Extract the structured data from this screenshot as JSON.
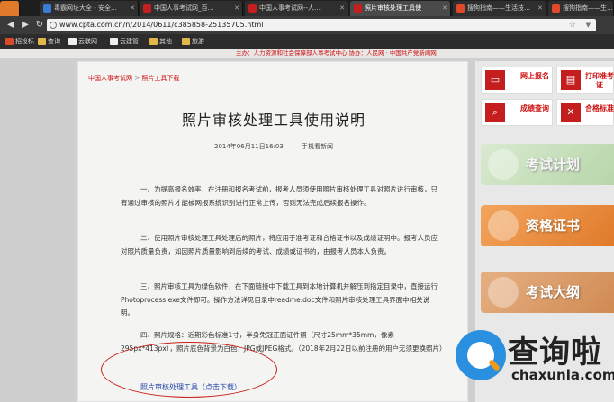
{
  "browser": {
    "tabs": [
      {
        "label": "毒霸网址大全 - 安全…",
        "color": "#3a7bd5"
      },
      {
        "label": "中国人事考试网_百…",
        "color": "#c41e1e"
      },
      {
        "label": "中国人事考试网--人…",
        "color": "#c41e1e"
      },
      {
        "label": "照片审核处理工具使",
        "color": "#c41e1e"
      },
      {
        "label": "搜狗指南——生活技…",
        "color": "#e04a2a"
      },
      {
        "label": "搜狗指南——生…",
        "color": "#e04a2a"
      }
    ],
    "url": "www.cpta.com.cn/n/2014/0611/c385858-25135705.html",
    "bookmarks": [
      "招投标",
      "查询",
      "云联网",
      "云建管",
      "其他",
      "旅游"
    ]
  },
  "page": {
    "top_strip": "主办：人力资源和社会保障部人事考试中心    协办：人民网 · 中国共产党新闻网",
    "breadcrumb": [
      "中国人事考试网",
      "照片工具下载"
    ],
    "breadcrumb_sep": ">",
    "title": "照片审核处理工具使用说明",
    "meta": "2014年06月11日16:03 手机看新闻",
    "paragraphs": [
      "一、为提高报名效率，在注册和报名考试前，报考人员须使用照片审核处理工具对照片进行审核，只有通过审核的照片才能被网报系统识别进行正常上传，否则无法完成后续报名操作。",
      "二、使用照片审核处理工具处理后的照片，将应用于准考证和合格证书以及成绩证明中。报考人员应对照片质量负责，如因照片质量影响到后续的考试、成绩或证书的，由报考人员本人负责。",
      "三、照片审核工具为绿色软件，在下面链接中下载工具到本地计算机并解压到指定目录中，直接运行Photoprocess.exe文件即可。操作方法详见目录中readme.doc文件和照片审核处理工具界面中相关说明。",
      "四、照片规格：近期彩色标准1寸，半身免冠正面证件照（尺寸25mm*35mm，像素295px*413px），照片底色背景为白色，JPG或JPEG格式。（2018年2月22日以前注册的用户无须更换照片）"
    ],
    "download_link": "照片审核处理工具（点击下载）"
  },
  "sidebar": {
    "quick_links": [
      {
        "label": "网上报名",
        "icon": "monitor-icon"
      },
      {
        "label": "打印准考证",
        "icon": "printer-icon"
      },
      {
        "label": "成绩查询",
        "icon": "search-doc-icon"
      },
      {
        "label": "合格标准",
        "icon": "tools-icon"
      }
    ],
    "banners": [
      "考试计划",
      "资格证书",
      "考试大纲"
    ]
  },
  "watermark": {
    "name": "查询啦",
    "domain": "chaxunla.com"
  },
  "colors": {
    "accent_red": "#c41e1e",
    "link_blue": "#2244aa",
    "annotation_red": "#c8201a"
  }
}
